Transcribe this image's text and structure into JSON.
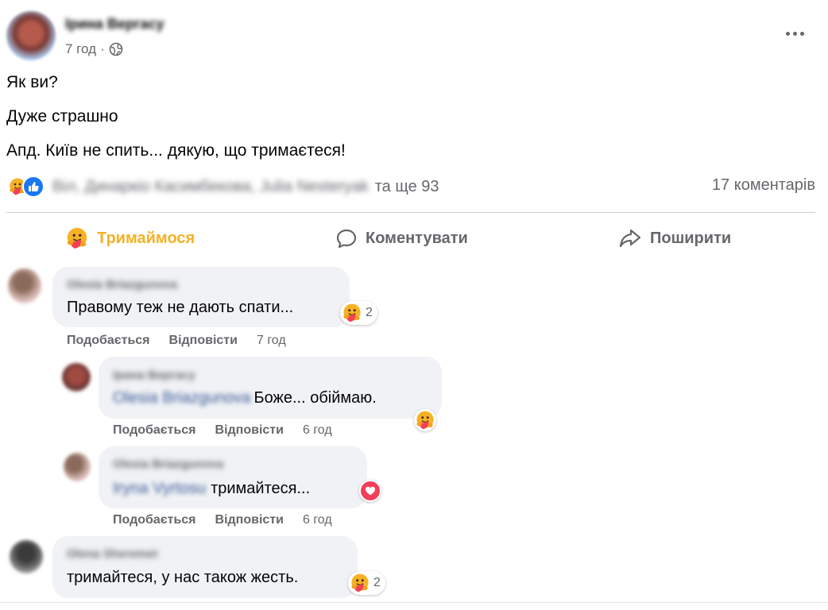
{
  "post": {
    "author": "Ірина Вергасу",
    "time": "7 год",
    "separator": "·",
    "lines": [
      "Як ви?",
      "Дуже страшно",
      "Апд. Київ не спить... дякую, що тримаєтеся!"
    ],
    "reactors": "Віл, Динаркіо Касимбекова, Julia Nesteryak",
    "and_more": "та ще 93",
    "comments_count": "17 коментарів"
  },
  "actions": {
    "hold": "Тримаймося",
    "comment": "Коментувати",
    "share": "Поширити"
  },
  "comments": [
    {
      "author": "Olesia Briazgunova",
      "text": "Правому теж не дають спати...",
      "reaction_count": "2",
      "like": "Подобається",
      "reply": "Відповісти",
      "time": "7 год"
    },
    {
      "author": "Ірина Вергасу",
      "mention": "Olesia Briazgunova",
      "text": "Боже... обіймаю.",
      "like": "Подобається",
      "reply": "Відповісти",
      "time": "6 год"
    },
    {
      "author": "Olesia Briazgunova",
      "mention": "Iryna Vyrtosu",
      "text": "тримайтеся...",
      "like": "Подобається",
      "reply": "Відповісти",
      "time": "6 год"
    },
    {
      "author": "Olena Sheremet",
      "text": "тримайтеся, у нас також жесть.",
      "reaction_count": "2"
    }
  ],
  "icons": {
    "care": "care-reaction-icon",
    "like": "like-reaction-icon",
    "love": "love-reaction-icon",
    "globe": "globe-icon",
    "more": "more-options-icon",
    "comment": "comment-bubble-icon",
    "share": "share-arrow-icon"
  },
  "colors": {
    "accent_care": "#f7b125",
    "like_blue": "#1877f2",
    "love_red": "#f33e58",
    "bubble_bg": "#f0f2f5",
    "secondary_text": "#65676b"
  }
}
